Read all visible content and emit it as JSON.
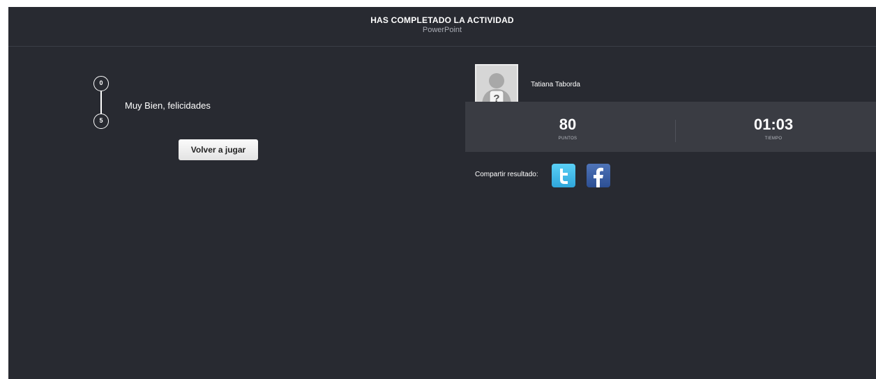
{
  "header": {
    "title": "HAS COMPLETADO LA ACTIVIDAD",
    "subtitle": "PowerPoint"
  },
  "progress": {
    "start_value": "0",
    "end_value": "5",
    "message": "Muy Bien, felicidades"
  },
  "replay_button": {
    "label": "Volver a jugar"
  },
  "user": {
    "name": "Tatiana Taborda",
    "avatar_icon": "unknown-user-icon"
  },
  "stats": {
    "points_value": "80",
    "points_label": "PUNTOS",
    "time_value": "01:03",
    "time_label": "TIEMPO"
  },
  "share": {
    "label": "Compartir resultado:",
    "twitter_icon": "twitter-icon",
    "facebook_icon": "facebook-icon"
  },
  "colors": {
    "background": "#282a31",
    "stats_bar": "#3a3c43",
    "twitter": "#35aee2",
    "facebook": "#3b5998"
  }
}
